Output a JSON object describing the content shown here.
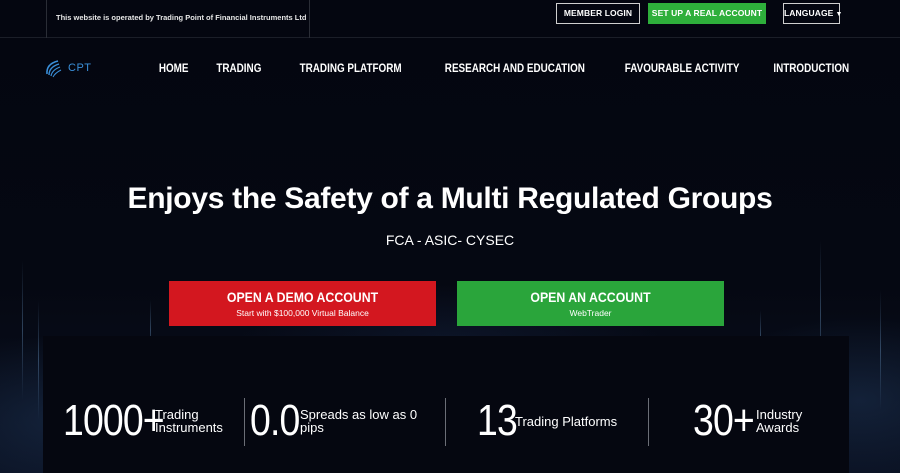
{
  "topbar": {
    "operator_text": "This website is operated by Trading Point of Financial Instruments Ltd",
    "member_login": "MEMBER LOGIN",
    "real_account": "SET UP A REAL ACCOUNT",
    "language": "LANGUAGE"
  },
  "logo": {
    "text": "CPT"
  },
  "nav": {
    "items": [
      {
        "label": "HOME"
      },
      {
        "label": "TRADING"
      },
      {
        "label": "TRADING PLATFORM"
      },
      {
        "label": "RESEARCH AND EDUCATION"
      },
      {
        "label": "FAVOURABLE ACTIVITY"
      },
      {
        "label": "INTRODUCTION"
      }
    ]
  },
  "hero": {
    "title": "Enjoys the Safety of a Multi Regulated Groups",
    "subtitle": "FCA - ASIC- CYSEC",
    "demo_button": {
      "label": "OPEN A DEMO ACCOUNT",
      "sub": "Start with $100,000 Virtual Balance"
    },
    "open_button": {
      "label": "OPEN AN ACCOUNT",
      "sub": "WebTrader"
    }
  },
  "stats": [
    {
      "number": "1000+",
      "label_line1": "Trading",
      "label_line2": "Instruments"
    },
    {
      "number": "0.0",
      "label_line1": "Spreads as low as 0",
      "label_line2": "pips"
    },
    {
      "number": "13",
      "label_line1": "Trading Platforms",
      "label_line2": ""
    },
    {
      "number": "30+",
      "label_line1": "Industry",
      "label_line2": "Awards"
    }
  ],
  "colors": {
    "green": "#2eaf3b",
    "red": "#d3171f",
    "logo_blue": "#3a8fd9"
  }
}
